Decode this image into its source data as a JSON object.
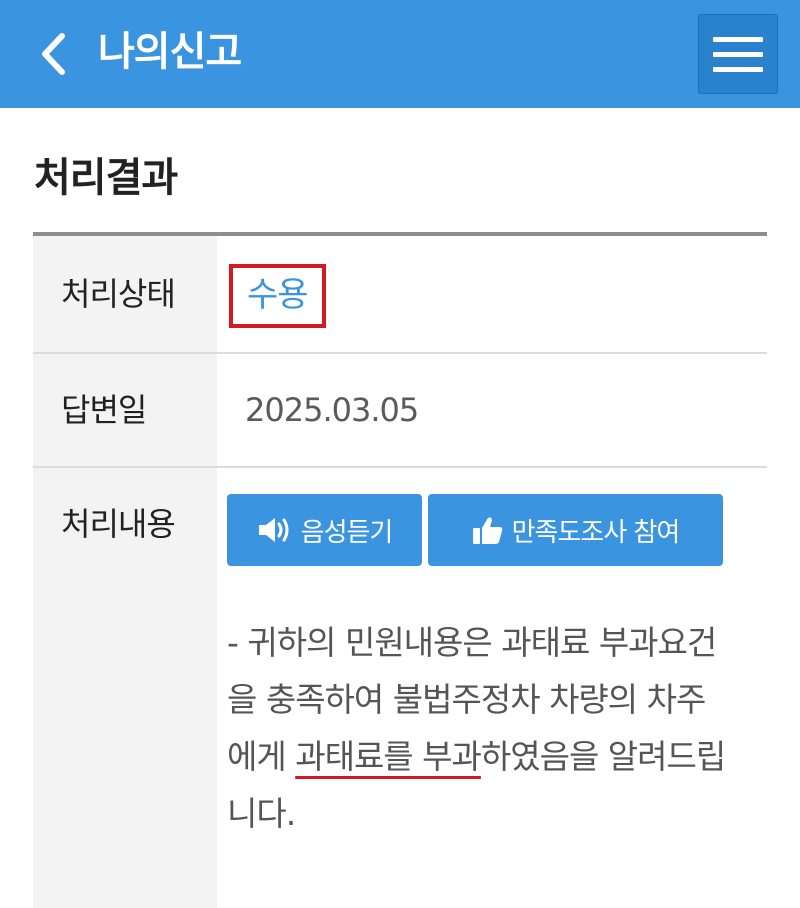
{
  "header": {
    "back_icon": "chevron-left-icon",
    "title": "나의신고",
    "menu_icon": "hamburger-menu-icon",
    "color": "#3a94e0"
  },
  "section": {
    "title": "처리결과"
  },
  "result": {
    "status_label": "처리상태",
    "status_value": "수용",
    "answer_date_label": "답변일",
    "answer_date_value": "2025.03.05",
    "content_label": "처리내용",
    "buttons": {
      "voice_label": "음성듣기",
      "voice_icon": "speaker-icon",
      "survey_label": "만족도조사 참여",
      "survey_icon": "thumbs-up-icon"
    },
    "content_text_part1": "- 귀하의 민원내용은 과태료 부과요건을 충족하여 불법주정차 차량의 차주에게 ",
    "content_text_highlight": "과태료를 부과",
    "content_text_part2": "하였음을 알려드립니다.",
    "highlight_color": "#d31a22"
  }
}
